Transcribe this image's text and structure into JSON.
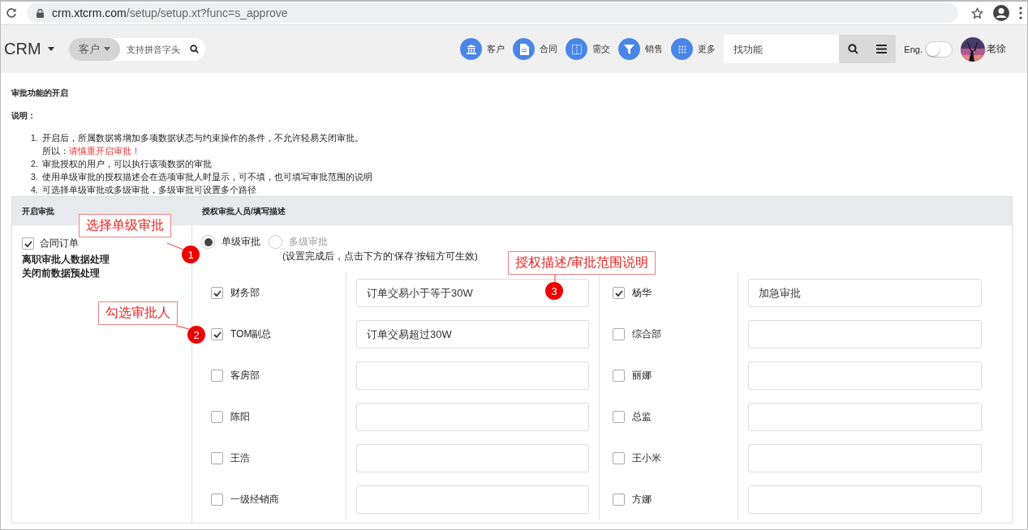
{
  "browser": {
    "url_host": "crm.xtcrm.com",
    "url_path": "/setup/setup.xt?func=s_approve"
  },
  "header": {
    "logo": "CRM",
    "scope": "客户",
    "search_placeholder": "支持拼音字头",
    "nav": [
      {
        "label": "客户",
        "kind": "bank"
      },
      {
        "label": "合同",
        "kind": "doc"
      },
      {
        "label": "需交",
        "kind": "columns"
      },
      {
        "label": "销售",
        "kind": "funnel"
      },
      {
        "label": "更多",
        "kind": "grid"
      }
    ],
    "function_search_placeholder": "找功能",
    "language_label": "Eng.",
    "language_on": false,
    "user": "老徐"
  },
  "page": {
    "title": "审批功能的开启",
    "note_heading": "说明：",
    "notes": [
      {
        "number": "1.",
        "text": "开启后，所属数据将增加多项数据状态与约束操作的条件，不允许轻易关闭审批。",
        "sub_prefix": "所以：",
        "sub_warning": "请慎重开启审批！"
      },
      {
        "number": "2.",
        "text": "审批授权的用户，可以执行该项数据的审批"
      },
      {
        "number": "3.",
        "text": "使用单级审批的授权描述会在选项审批人时显示，可不填，也可填写审批范围的说明"
      },
      {
        "number": "4.",
        "text": "可选择单级审批或多级审批，多级审批可设置多个路径"
      }
    ]
  },
  "table": {
    "columns": [
      "开启审批",
      "授权审批人员/填写描述"
    ],
    "modules": [
      {
        "label": "合同订单",
        "checked": true
      }
    ],
    "links": [
      "离职审批人数据处理",
      "关闭前数据预处理"
    ],
    "modes": [
      {
        "label": "单级审批",
        "selected": true
      },
      {
        "label": "多级审批",
        "selected": false
      }
    ],
    "mode_note": "(设置完成后，点击下方的‘保存’按钮方可生效)",
    "approvers": [
      {
        "name": "财务部",
        "checked": true,
        "description": "订单交易小于等于30W"
      },
      {
        "name": "杨华",
        "checked": true,
        "description": "加急审批"
      },
      {
        "name": "TOM副总",
        "checked": true,
        "description": "订单交易超过30W"
      },
      {
        "name": "综合部",
        "checked": false
      },
      {
        "name": "客房部",
        "checked": false
      },
      {
        "name": "丽娜",
        "checked": false
      },
      {
        "name": "陈阳",
        "checked": false
      },
      {
        "name": "总监",
        "checked": false
      },
      {
        "name": "王浩",
        "checked": false
      },
      {
        "name": "王小米",
        "checked": false
      },
      {
        "name": "一级经销商",
        "checked": false
      },
      {
        "name": "方娜",
        "checked": false
      }
    ]
  },
  "callouts": [
    {
      "text": "选择单级审批",
      "number": "1"
    },
    {
      "text": "勾选审批人",
      "number": "2"
    },
    {
      "text": "授权描述/审批范围说明",
      "number": "3"
    }
  ]
}
